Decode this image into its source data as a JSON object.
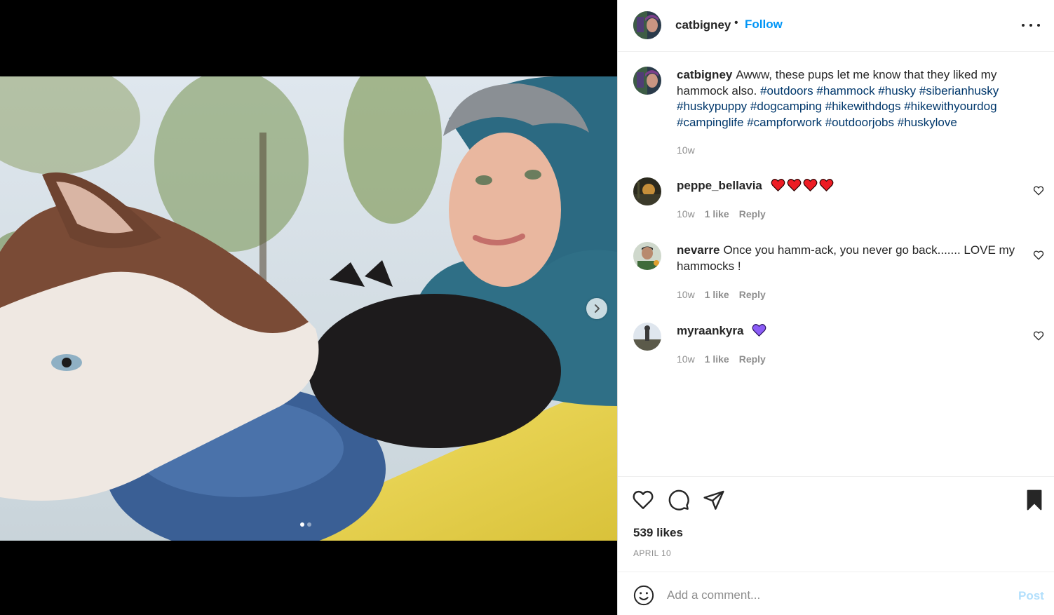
{
  "post": {
    "username": "catbigney",
    "follow_label": "Follow",
    "separator": "•",
    "caption": {
      "username": "catbigney",
      "text": "Awww, these pups let me know that they liked my hammock also.",
      "hashtags": [
        "#outdoors",
        "#hammock",
        "#husky",
        "#siberianhusky",
        "#huskypuppy",
        "#dogcamping",
        "#hikewithdogs",
        "#hikewithyourdog",
        "#campinglife",
        "#campforwork",
        "#outdoorjobs",
        "#huskylove"
      ],
      "time": "10w"
    },
    "carousel": {
      "current": 1,
      "total": 2
    }
  },
  "comments": [
    {
      "username": "peppe_bellavia",
      "text": "",
      "emoji": "red-heart x4",
      "time": "10w",
      "likes": "1 like",
      "reply": "Reply"
    },
    {
      "username": "nevarre",
      "text": "Once you hamm-ack, you never go back....... LOVE my hammocks !",
      "time": "10w",
      "likes": "1 like",
      "reply": "Reply"
    },
    {
      "username": "myraankyra",
      "text": "",
      "emoji": "purple-heart",
      "time": "10w",
      "likes": "1 like",
      "reply": "Reply"
    }
  ],
  "footer": {
    "likes": "539 likes",
    "date": "APRIL 10",
    "comment_placeholder": "Add a comment...",
    "post_label": "Post"
  },
  "colors": {
    "link_blue": "#0095f6",
    "hashtag": "#00376b",
    "muted": "#8e8e8e",
    "post_disabled": "#b2dffc",
    "heart_red": "#ed1c24",
    "heart_purple": "#8b5cf6"
  },
  "icons": [
    "more-icon",
    "chevron-right-icon",
    "heart-outline-icon",
    "comment-icon",
    "share-icon",
    "bookmark-icon",
    "emoji-icon"
  ]
}
